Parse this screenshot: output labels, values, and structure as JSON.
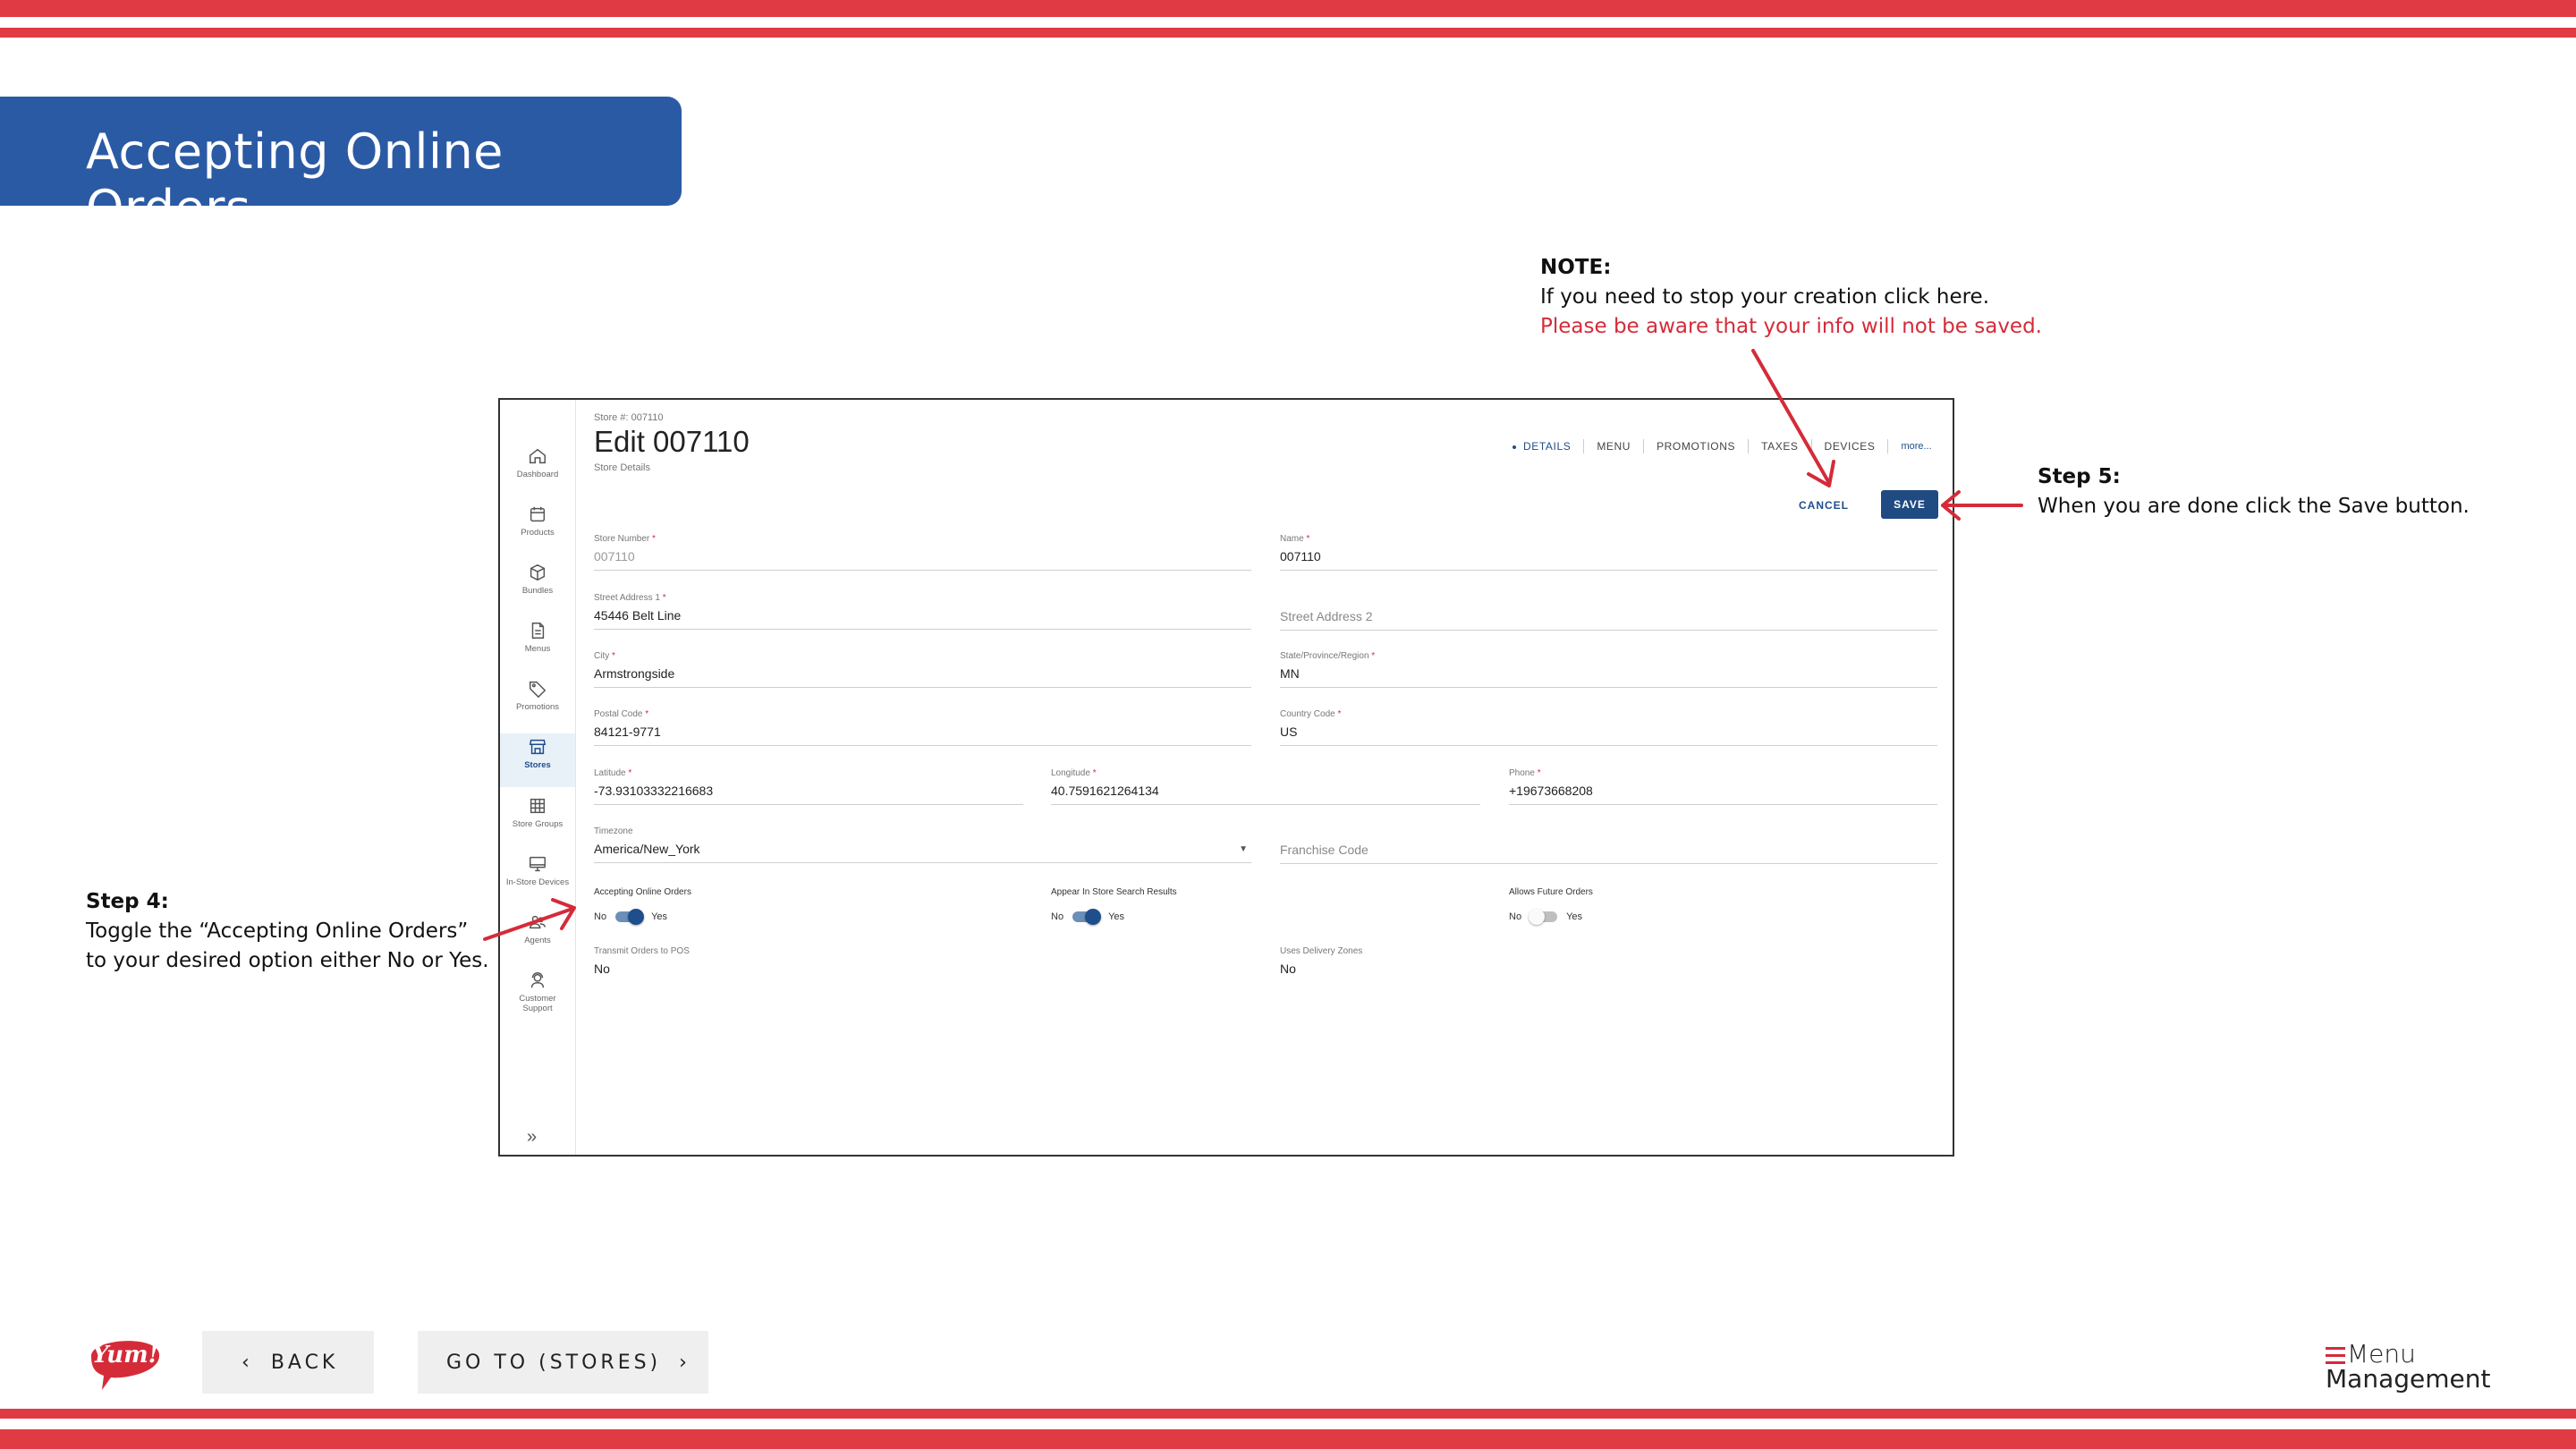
{
  "slide": {
    "title": "Accepting Online Orders",
    "colors": {
      "stripe": "#e03a44",
      "title_bg": "#2b5aa4",
      "accent": "#1f4e8c",
      "annotation_red": "#d52b39"
    }
  },
  "annotations": {
    "note": {
      "heading": "NOTE:",
      "line1": "If you need to stop your creation click here.",
      "line2": "Please be aware that your info will not be saved."
    },
    "step5": {
      "heading": "Step 5:",
      "text": "When you are done click the Save button."
    },
    "step4": {
      "heading": "Step 4:",
      "line1": "Toggle the “Accepting Online Orders”",
      "line2": "to your desired option either No or Yes."
    }
  },
  "app": {
    "sidebar": {
      "items": [
        {
          "label": "Dashboard",
          "icon": "home-icon"
        },
        {
          "label": "Products",
          "icon": "calendar-icon"
        },
        {
          "label": "Bundles",
          "icon": "box-icon"
        },
        {
          "label": "Menus",
          "icon": "document-icon"
        },
        {
          "label": "Promotions",
          "icon": "tag-icon"
        },
        {
          "label": "Stores",
          "icon": "store-icon",
          "active": true
        },
        {
          "label": "Store Groups",
          "icon": "grid-icon"
        },
        {
          "label": "In-Store Devices",
          "icon": "monitor-icon"
        },
        {
          "label": "Agents",
          "icon": "agents-icon"
        },
        {
          "label": "Customer Support",
          "icon": "support-icon"
        }
      ],
      "expand_glyph": "»"
    },
    "header": {
      "store_number_label": "Store #: 007110",
      "title": "Edit 007110",
      "subtitle": "Store Details"
    },
    "tabs": [
      {
        "label": "DETAILS",
        "active": true
      },
      {
        "label": "MENU"
      },
      {
        "label": "PROMOTIONS"
      },
      {
        "label": "TAXES"
      },
      {
        "label": "DEVICES"
      },
      {
        "label": "more..."
      }
    ],
    "actions": {
      "cancel": "CANCEL",
      "save": "SAVE"
    },
    "fields": {
      "store_number": {
        "label": "Store Number",
        "value": "007110"
      },
      "name": {
        "label": "Name",
        "value": "007110"
      },
      "street1": {
        "label": "Street Address 1",
        "value": "45446 Belt Line"
      },
      "street2": {
        "placeholder": "Street Address 2"
      },
      "city": {
        "label": "City",
        "value": "Armstrongside"
      },
      "state": {
        "label": "State/Province/Region",
        "value": "MN"
      },
      "postal": {
        "label": "Postal Code",
        "value": "84121-9771"
      },
      "country": {
        "label": "Country Code",
        "value": "US"
      },
      "latitude": {
        "label": "Latitude",
        "value": "-73.93103332216683"
      },
      "longitude": {
        "label": "Longitude",
        "value": "40.7591621264134"
      },
      "phone": {
        "label": "Phone",
        "value": "+19673668208"
      },
      "timezone": {
        "label": "Timezone",
        "value": "America/New_York"
      },
      "franchise": {
        "placeholder": "Franchise Code"
      },
      "transmit": {
        "label": "Transmit Orders to POS",
        "value": "No"
      },
      "delivery_zones": {
        "label": "Uses Delivery Zones",
        "value": "No"
      }
    },
    "toggles": {
      "accepting_online": {
        "label": "Accepting Online Orders",
        "off_label": "No",
        "on_label": "Yes",
        "on": true
      },
      "appear_search": {
        "label": "Appear In Store Search Results",
        "off_label": "No",
        "on_label": "Yes",
        "on": true
      },
      "future_orders": {
        "label": "Allows Future Orders",
        "off_label": "No",
        "on_label": "Yes",
        "on": false
      }
    },
    "required_marker": "*"
  },
  "footer": {
    "back": "BACK",
    "go_to": "GO TO (STORES)",
    "yum_logo": "Yum!",
    "mm_logo_line1": "Menu",
    "mm_logo_line2": "Management"
  }
}
